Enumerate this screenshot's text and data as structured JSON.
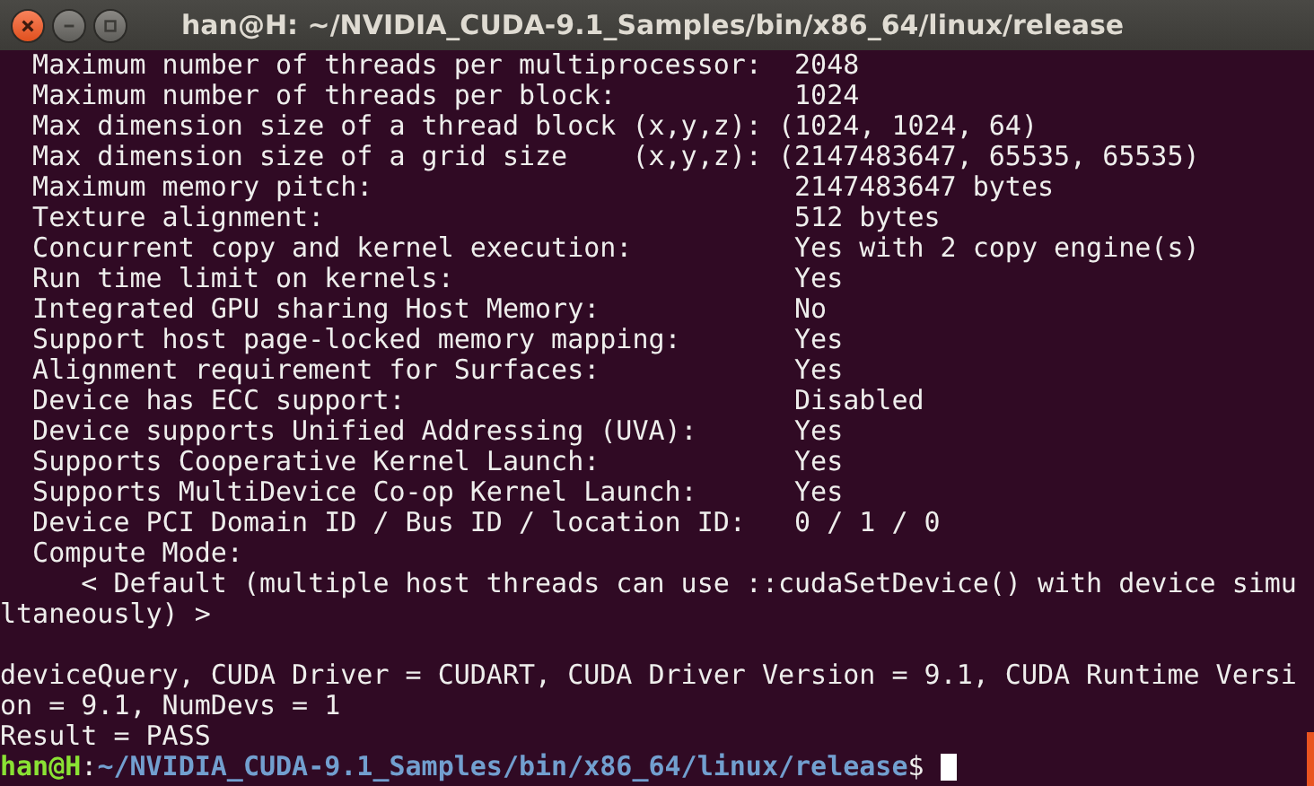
{
  "window": {
    "title": "han@H: ~/NVIDIA_CUDA-9.1_Samples/bin/x86_64/linux/release"
  },
  "terminal": {
    "lines": [
      {
        "kind": "output",
        "text": "  Maximum number of threads per multiprocessor:  2048"
      },
      {
        "kind": "output",
        "text": "  Maximum number of threads per block:           1024"
      },
      {
        "kind": "output",
        "text": "  Max dimension size of a thread block (x,y,z): (1024, 1024, 64)"
      },
      {
        "kind": "output",
        "text": "  Max dimension size of a grid size    (x,y,z): (2147483647, 65535, 65535)"
      },
      {
        "kind": "output",
        "text": "  Maximum memory pitch:                          2147483647 bytes"
      },
      {
        "kind": "output",
        "text": "  Texture alignment:                             512 bytes"
      },
      {
        "kind": "output",
        "text": "  Concurrent copy and kernel execution:          Yes with 2 copy engine(s)"
      },
      {
        "kind": "output",
        "text": "  Run time limit on kernels:                     Yes"
      },
      {
        "kind": "output",
        "text": "  Integrated GPU sharing Host Memory:            No"
      },
      {
        "kind": "output",
        "text": "  Support host page-locked memory mapping:       Yes"
      },
      {
        "kind": "output",
        "text": "  Alignment requirement for Surfaces:            Yes"
      },
      {
        "kind": "output",
        "text": "  Device has ECC support:                        Disabled"
      },
      {
        "kind": "output",
        "text": "  Device supports Unified Addressing (UVA):      Yes"
      },
      {
        "kind": "output",
        "text": "  Supports Cooperative Kernel Launch:            Yes"
      },
      {
        "kind": "output",
        "text": "  Supports MultiDevice Co-op Kernel Launch:      Yes"
      },
      {
        "kind": "output",
        "text": "  Device PCI Domain ID / Bus ID / location ID:   0 / 1 / 0"
      },
      {
        "kind": "output",
        "text": "  Compute Mode:"
      },
      {
        "kind": "output",
        "text": "     < Default (multiple host threads can use ::cudaSetDevice() with device simu"
      },
      {
        "kind": "output",
        "text": "ltaneously) >"
      },
      {
        "kind": "blank"
      },
      {
        "kind": "output",
        "text": "deviceQuery, CUDA Driver = CUDART, CUDA Driver Version = 9.1, CUDA Runtime Versi"
      },
      {
        "kind": "output",
        "text": "on = 9.1, NumDevs = 1"
      },
      {
        "kind": "output",
        "text": "Result = PASS"
      },
      {
        "kind": "prompt",
        "user_host": "han@H",
        "separator": ":",
        "path": "~/NVIDIA_CUDA-9.1_Samples/bin/x86_64/linux/release",
        "symbol": "$"
      }
    ]
  }
}
